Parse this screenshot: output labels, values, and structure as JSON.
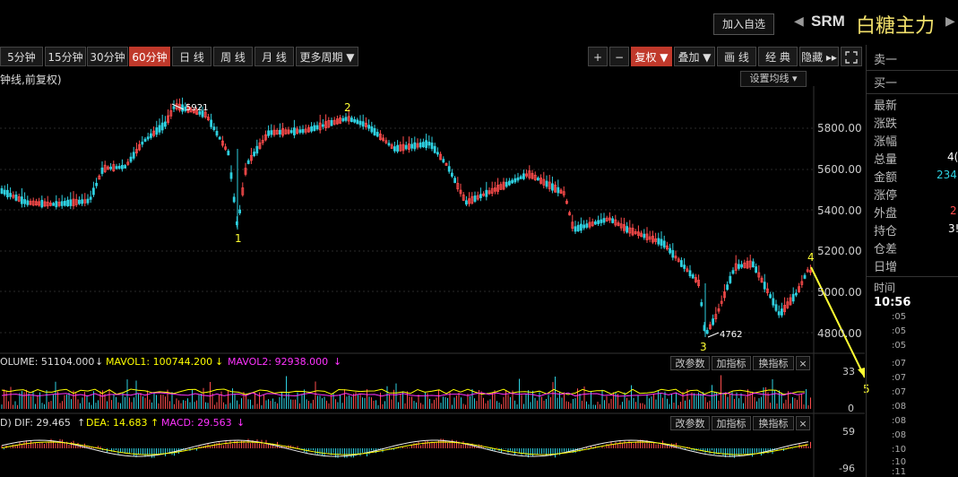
{
  "header": {
    "add_watch_label": "加入自选",
    "symbol_code": "SRM",
    "symbol_name": "白糖主力",
    "prev_symbol_glyph": "◀",
    "next_symbol_glyph": "▶"
  },
  "toolbar": {
    "periods": [
      {
        "label": "5分钟",
        "active": false
      },
      {
        "label": "15分钟",
        "active": false
      },
      {
        "label": "30分钟",
        "active": false
      },
      {
        "label": "60分钟",
        "active": true
      },
      {
        "label": "日 线",
        "active": false
      },
      {
        "label": "周 线",
        "active": false
      },
      {
        "label": "月 线",
        "active": false
      },
      {
        "label": "更多周期 ▼",
        "active": false
      }
    ],
    "zoom_in": "+",
    "zoom_out": "−",
    "restore_rights": "复权 ▼",
    "overlay": "叠加 ▼",
    "draw_line": "画 线",
    "classic": "经 典",
    "hide": "隐藏 ▸▸",
    "fullscreen_icon": "fullscreen-icon"
  },
  "chart": {
    "title": "钟线,前复权)",
    "ma_setting_label": "设置均线 ▾",
    "price_ticks": [
      "5800.00",
      "5600.00",
      "5400.00",
      "5200.00",
      "5000.00",
      "4800.00"
    ],
    "high_label": "5921",
    "low_label": "4762",
    "wave_labels": [
      "1",
      "2",
      "3",
      "4",
      "5"
    ],
    "colors": {
      "up": "#ff4d4d",
      "down": "#2ed0e0",
      "wave": "#ffff33",
      "ma1": "#ffff00",
      "ma2": "#ff33ff"
    }
  },
  "volume_panel": {
    "volume_text": "OLUME: 51104.000",
    "mavol1_text": "MAVOL1: 100744.200",
    "mavol2_text": "MAVOL2: 92938.000",
    "ticks": [
      "33",
      "0"
    ],
    "btn_params": "改参数",
    "btn_add_indicator": "加指标",
    "btn_switch_indicator": "换指标",
    "btn_close": "×"
  },
  "macd_panel": {
    "prefix": "D)",
    "dif_text": "DIF: 29.465",
    "dea_text": "DEA: 14.683",
    "macd_text": "MACD: 29.563",
    "ticks": [
      "59",
      "-96"
    ],
    "btn_params": "改参数",
    "btn_add_indicator": "加指标",
    "btn_switch_indicator": "换指标",
    "btn_close": "×"
  },
  "quote_panel": {
    "sell1": "卖一",
    "buy1": "买一",
    "rows": [
      {
        "label": "最新",
        "value": ""
      },
      {
        "label": "涨跌",
        "value": ""
      },
      {
        "label": "涨幅",
        "value": ""
      },
      {
        "label": "总量",
        "value": "4("
      },
      {
        "label": "金额",
        "value": "234"
      },
      {
        "label": "涨停",
        "value": ""
      },
      {
        "label": "外盘",
        "value": "2"
      },
      {
        "label": "持仓",
        "value": "3!"
      },
      {
        "label": "仓差",
        "value": ""
      },
      {
        "label": "日增",
        "value": ""
      }
    ],
    "time_header": "时间",
    "time_current": "10:56",
    "time_ticks": [
      ":05",
      ":05",
      ":05",
      ":07",
      ":07",
      ":07",
      ":08",
      ":08",
      ":08",
      ":10",
      ":10",
      ":11"
    ]
  }
}
